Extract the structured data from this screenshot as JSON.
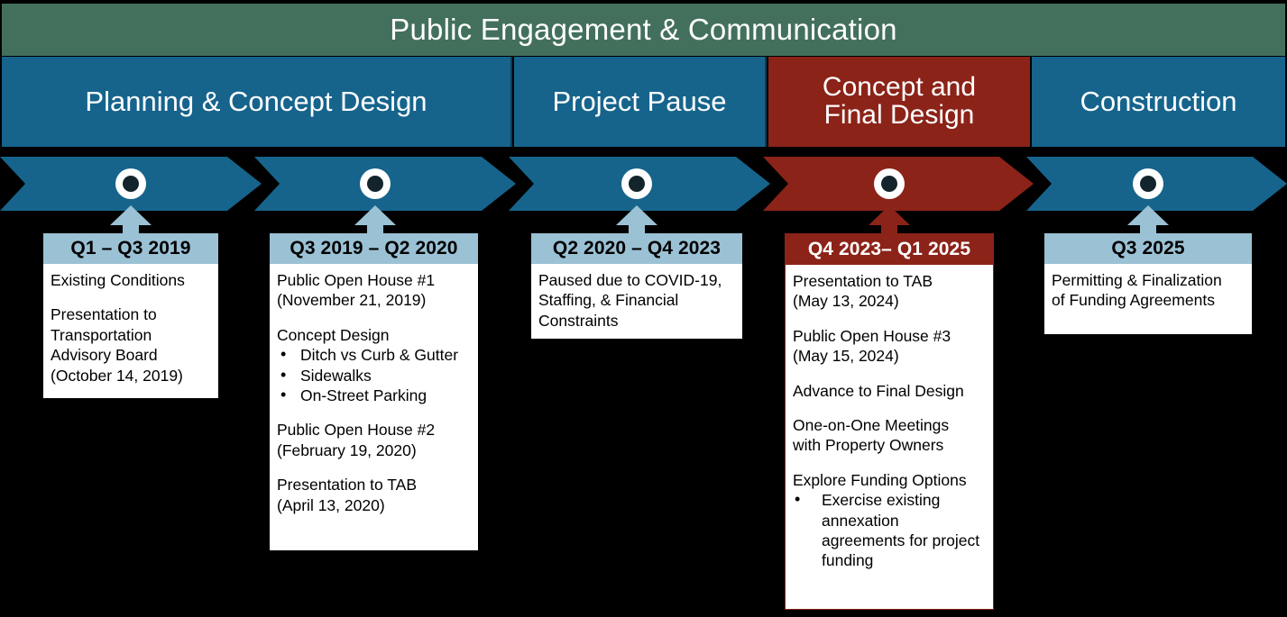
{
  "banner": {
    "title": "Public Engagement & Communication",
    "color": "#43705c"
  },
  "colors": {
    "blue": "#16648c",
    "red": "#8c2318",
    "light_blue": "#9bc1d4",
    "green": "#43705c",
    "marker_center": "#13242c",
    "background": "#000000"
  },
  "stages": [
    {
      "label": "Planning & Concept Design",
      "color": "#16648c",
      "accent": "blue"
    },
    {
      "label": "Project Pause",
      "color": "#16648c",
      "accent": "blue"
    },
    {
      "label": "Concept and\nFinal Design",
      "line1": "Concept and",
      "line2": "Final Design",
      "color": "#8c2318",
      "accent": "red"
    },
    {
      "label": "Construction",
      "color": "#16648c",
      "accent": "blue"
    }
  ],
  "milestones": [
    {
      "period": "Q1 – Q3 2019",
      "accent": "blue",
      "blocks": [
        {
          "type": "text",
          "text": "Existing Conditions"
        },
        {
          "type": "text",
          "text": "Presentation to Transportation Advisory Board (October 14, 2019)"
        }
      ]
    },
    {
      "period": "Q3 2019 – Q2 2020",
      "accent": "blue",
      "blocks": [
        {
          "type": "text",
          "text": "Public Open House #1"
        },
        {
          "type": "text",
          "text": "(November 21, 2019)"
        },
        {
          "type": "text",
          "text": "Concept Design"
        },
        {
          "type": "bullet",
          "text": "Ditch vs Curb & Gutter"
        },
        {
          "type": "bullet",
          "text": "Sidewalks"
        },
        {
          "type": "bullet",
          "text": "On-Street Parking"
        },
        {
          "type": "text",
          "text": "Public Open House #2"
        },
        {
          "type": "text",
          "text": "(February 19, 2020)"
        },
        {
          "type": "text",
          "text": "Presentation to TAB"
        },
        {
          "type": "text",
          "text": "(April 13, 2020)"
        }
      ]
    },
    {
      "period": "Q2 2020 – Q4 2023",
      "accent": "blue",
      "blocks": [
        {
          "type": "text",
          "text": "Paused due to COVID-19, Staffing, & Financial Constraints"
        }
      ]
    },
    {
      "period": "Q4 2023– Q1 2025",
      "accent": "red",
      "blocks": [
        {
          "type": "text",
          "text": "Presentation to TAB"
        },
        {
          "type": "text",
          "text": "(May 13, 2024)"
        },
        {
          "type": "text",
          "text": "Public Open House #3"
        },
        {
          "type": "text",
          "text": "(May 15, 2024)"
        },
        {
          "type": "text",
          "text": "Advance to Final Design"
        },
        {
          "type": "text",
          "text": "One-on-One Meetings with Property Owners"
        },
        {
          "type": "text",
          "text": "Explore Funding Options"
        },
        {
          "type": "bullet",
          "text": "Exercise existing annexation agreements for project funding"
        }
      ]
    },
    {
      "period": "Q3 2025",
      "accent": "blue",
      "blocks": [
        {
          "type": "text",
          "text": "Permitting & Finalization of Funding Agreements"
        }
      ]
    }
  ],
  "card1": {
    "period": "Q1 – Q3 2019",
    "l1": "Existing Conditions",
    "l2": "Presentation to",
    "l3": "Transportation",
    "l4": "Advisory Board",
    "l5": "(October 14, 2019)"
  },
  "card2": {
    "period": "Q3 2019 – Q2 2020",
    "l1": "Public Open House #1",
    "l2": "(November 21, 2019)",
    "l3": "Concept Design",
    "b1": "Ditch vs Curb & Gutter",
    "b2": "Sidewalks",
    "b3": "On-Street Parking",
    "l4": "Public Open House #2",
    "l5": "(February 19, 2020)",
    "l6": "Presentation to TAB",
    "l7": "(April 13, 2020)"
  },
  "card3": {
    "period": "Q2 2020 – Q4 2023",
    "l1": "Paused due to COVID-19,",
    "l2": "Staffing, & Financial",
    "l3": "Constraints"
  },
  "card4": {
    "period": "Q4 2023– Q1 2025",
    "l1": "Presentation to TAB",
    "l2": "(May 13, 2024)",
    "l3": "Public Open House #3",
    "l4": "(May 15, 2024)",
    "l5": "Advance to Final Design",
    "l6": "One-on-One Meetings",
    "l7": "with Property Owners",
    "l8": "Explore Funding Options",
    "b1": "Exercise existing annexation agreements for project funding"
  },
  "card5": {
    "period": "Q3 2025",
    "l1": "Permitting & Finalization",
    "l2": "of Funding Agreements"
  }
}
